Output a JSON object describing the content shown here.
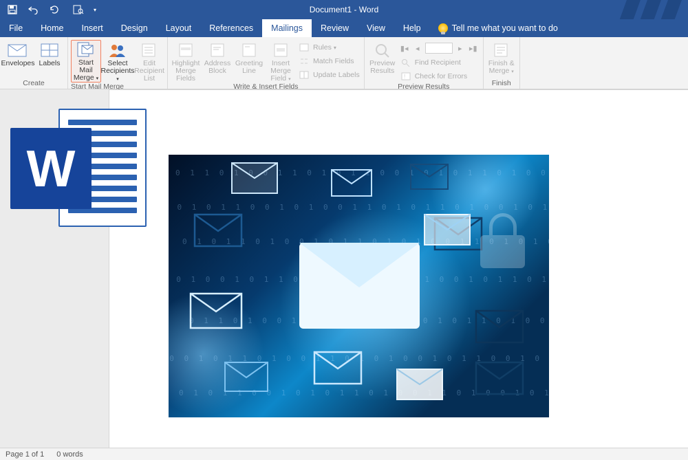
{
  "title": "Document1 - Word",
  "tellme_placeholder": "Tell me what you want to do",
  "tabs": [
    "File",
    "Home",
    "Insert",
    "Design",
    "Layout",
    "References",
    "Mailings",
    "Review",
    "View",
    "Help"
  ],
  "active_tab_index": 6,
  "ribbon": {
    "groups": [
      {
        "label": "Create",
        "buttons": [
          "Envelopes",
          "Labels"
        ]
      },
      {
        "label": "Start Mail Merge",
        "buttons": [
          "Start Mail Merge",
          "Select Recipients",
          "Edit Recipient List"
        ]
      },
      {
        "label": "Write & Insert Fields",
        "big": [
          "Highlight Merge Fields",
          "Address Block",
          "Greeting Line",
          "Insert Merge Field"
        ],
        "small": [
          "Rules",
          "Match Fields",
          "Update Labels"
        ]
      },
      {
        "label": "Preview Results",
        "big": [
          "Preview Results"
        ],
        "small": [
          "Find Recipient",
          "Check for Errors"
        ]
      },
      {
        "label": "Finish",
        "buttons": [
          "Finish & Merge"
        ]
      }
    ]
  },
  "status": {
    "page": "Page 1 of 1",
    "words": "0 words"
  }
}
